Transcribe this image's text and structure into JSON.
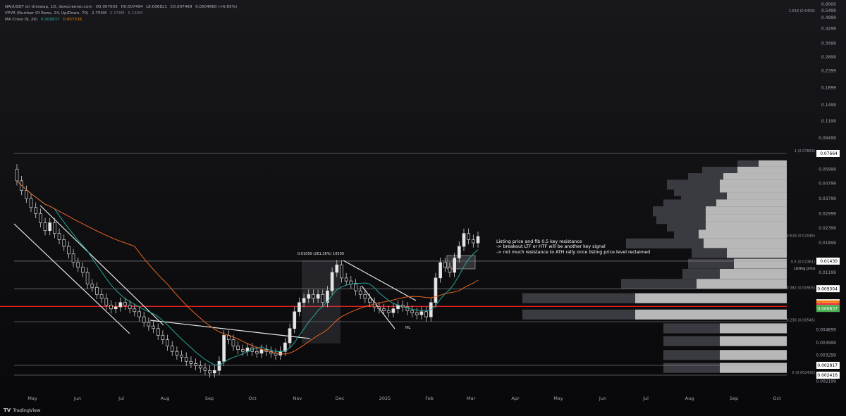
{
  "header": {
    "symbol_line": "NAI/USDT on Uniswap, 1D, dexscreener.com",
    "ohlc": [
      "O0.007003",
      "H0.007494",
      "L0.006821",
      "C0.007469",
      "0.0004660 (+6.65%)"
    ],
    "vpvr_label": "VPVR (Number Of Rows, 24, Up/Down, 70)",
    "vpvr_values": [
      "2.755M",
      "2.378M",
      "5.133M"
    ],
    "ma_label": "MA Cross (9, 26)",
    "ma_fast": "0.006837",
    "ma_slow": "0.007336"
  },
  "annotation": {
    "lines": [
      "Listing price and fib 0.5 key resistance",
      "-> breakout LTF or HTF will be another key signal",
      "-> not much resistance to ATH rally once listing price level reclaimed"
    ]
  },
  "logo": {
    "text": "TradingView",
    "mark": "TV"
  },
  "chart_data": {
    "type": "candlestick",
    "scale": "log",
    "ylim": [
      0.0021,
      0.6
    ],
    "price_ticks": [
      "0.6000",
      "0.5499",
      "0.4999",
      "0.4299",
      "0.3499",
      "0.2899",
      "0.2399",
      "0.1899",
      "0.1499",
      "0.1199",
      "0.09499",
      "0.07664",
      "0.05999",
      "0.04799",
      "0.03799",
      "0.02999",
      "0.02399",
      "0.01899",
      "0.01430",
      "0.01199",
      "0.009304",
      "0.007469",
      "0.007336",
      "0.007055",
      "0.006837",
      "0.004899",
      "0.003999",
      "0.003299",
      "0.002817",
      "0.002416",
      "0.002199"
    ],
    "highlighted_price_labels": [
      {
        "text": "0.07664",
        "color": "#ffffff",
        "text_color": "#000000"
      },
      {
        "text": "0.01430",
        "color": "#ffffff",
        "text_color": "#000000"
      },
      {
        "text": "0.009304",
        "color": "#ffffff",
        "text_color": "#000000"
      },
      {
        "text": "0.007469",
        "color": "#ffffff",
        "text_color": "#000000"
      },
      {
        "text": "0.007336",
        "color": "#f57c00",
        "text_color": "#ffffff"
      },
      {
        "text": "0.007055",
        "color": "#f23645",
        "text_color": "#ffffff"
      },
      {
        "text": "0.006837",
        "color": "#4caf50",
        "text_color": "#ffffff"
      },
      {
        "text": "0.002817",
        "color": "#ffffff",
        "text_color": "#000000"
      },
      {
        "text": "0.002416",
        "color": "#ffffff",
        "text_color": "#000000"
      }
    ],
    "x_ticks": [
      "May",
      "Jun",
      "Jul",
      "Aug",
      "Sep",
      "Oct",
      "Nov",
      "Dec",
      "2025",
      "Feb",
      "Mar",
      "Apr",
      "May",
      "Jun",
      "Jul",
      "Aug",
      "Sep",
      "Oct"
    ],
    "fib_levels": [
      {
        "label": "1.618 (0.6409)",
        "price": 0.6409
      },
      {
        "label": "1 (0.07663)",
        "price": 0.07663
      },
      {
        "label": "0.618 (0.02046)",
        "price": 0.02046
      },
      {
        "label": "0.5 (0.01361)",
        "price": 0.01361
      },
      {
        "label": "0.382 (0.00905)",
        "price": 0.00905
      },
      {
        "label": "0.236 (0.00546)",
        "price": 0.00546
      },
      {
        "label": "0 (0.002416)",
        "price": 0.002416
      }
    ],
    "horizontal_levels": [
      0.07664,
      0.0143,
      0.009304,
      0.007055,
      0.005563,
      0.002817,
      0.002416
    ],
    "red_level": 0.007055,
    "listing_label": "Listing price",
    "measure_label": "0.01050 (261.26%) 10500",
    "hl_label": "HL",
    "close_series": [
      0.05,
      0.043,
      0.038,
      0.033,
      0.03,
      0.026,
      0.023,
      0.026,
      0.022,
      0.02,
      0.018,
      0.016,
      0.014,
      0.013,
      0.012,
      0.01,
      0.0095,
      0.0085,
      0.008,
      0.0072,
      0.0068,
      0.007,
      0.0075,
      0.0072,
      0.0068,
      0.0065,
      0.006,
      0.0055,
      0.0052,
      0.005,
      0.0045,
      0.0042,
      0.0038,
      0.0035,
      0.0033,
      0.0032,
      0.003,
      0.0029,
      0.0028,
      0.0027,
      0.0026,
      0.0025,
      0.0026,
      0.003,
      0.0045,
      0.0042,
      0.0038,
      0.0036,
      0.0035,
      0.0037,
      0.0035,
      0.0034,
      0.0036,
      0.0035,
      0.0034,
      0.0033,
      0.0035,
      0.004,
      0.005,
      0.0065,
      0.0075,
      0.008,
      0.0085,
      0.008,
      0.0085,
      0.0075,
      0.009,
      0.012,
      0.0135,
      0.011,
      0.0105,
      0.01,
      0.009,
      0.0085,
      0.008,
      0.0075,
      0.007,
      0.0068,
      0.0066,
      0.0064,
      0.0068,
      0.0072,
      0.007,
      0.0066,
      0.0064,
      0.0062,
      0.0065,
      0.006,
      0.0075,
      0.011,
      0.014,
      0.013,
      0.012,
      0.015,
      0.018,
      0.022,
      0.02,
      0.019,
      0.021
    ],
    "volume_profile": [
      {
        "price": 0.0635,
        "total_px": 70,
        "up_px": 40
      },
      {
        "price": 0.0575,
        "total_px": 120,
        "up_px": 70
      },
      {
        "price": 0.052,
        "total_px": 140,
        "up_px": 90
      },
      {
        "price": 0.047,
        "total_px": 170,
        "up_px": 95
      },
      {
        "price": 0.0425,
        "total_px": 160,
        "up_px": 95
      },
      {
        "price": 0.0385,
        "total_px": 150,
        "up_px": 85
      },
      {
        "price": 0.0345,
        "total_px": 175,
        "up_px": 100
      },
      {
        "price": 0.031,
        "total_px": 190,
        "up_px": 115
      },
      {
        "price": 0.0275,
        "total_px": 185,
        "up_px": 115
      },
      {
        "price": 0.0245,
        "total_px": 170,
        "up_px": 115
      },
      {
        "price": 0.0215,
        "total_px": 160,
        "up_px": 125
      },
      {
        "price": 0.0188,
        "total_px": 228,
        "up_px": 118
      },
      {
        "price": 0.0162,
        "total_px": 135,
        "up_px": 85
      },
      {
        "price": 0.0137,
        "total_px": 140,
        "up_px": 75
      },
      {
        "price": 0.0117,
        "total_px": 148,
        "up_px": 95
      },
      {
        "price": 0.01,
        "total_px": 235,
        "up_px": 128
      },
      {
        "price": 0.008,
        "total_px": 375,
        "up_px": 215
      },
      {
        "price": 0.0062,
        "total_px": 375,
        "up_px": 215
      },
      {
        "price": 0.005,
        "total_px": 175,
        "up_px": 95
      },
      {
        "price": 0.0041,
        "total_px": 175,
        "up_px": 95
      },
      {
        "price": 0.0033,
        "total_px": 175,
        "up_px": 95
      },
      {
        "price": 0.0027,
        "total_px": 175,
        "up_px": 95
      }
    ]
  }
}
